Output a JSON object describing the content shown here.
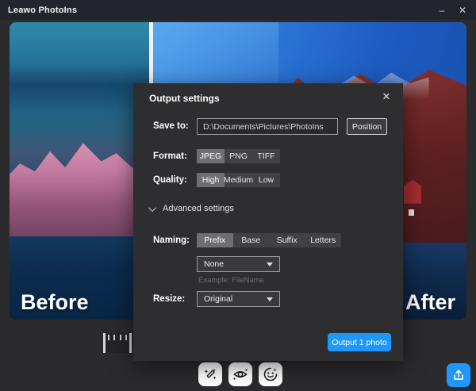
{
  "titlebar": {
    "title": "Leawo PhotoIns",
    "minimize": "–",
    "close": "✕"
  },
  "photo": {
    "before_label": "Before",
    "after_label": "After"
  },
  "dialog": {
    "title": "Output settings",
    "close": "✕",
    "save_to": {
      "label": "Save to:",
      "value": "D:\\Documents\\Pictures\\PhotoIns",
      "position_button": "Position"
    },
    "format": {
      "label": "Format:",
      "options": [
        "JPEG",
        "PNG",
        "TIFF"
      ],
      "selected": "JPEG"
    },
    "quality": {
      "label": "Quality:",
      "options": [
        "High",
        "Medium",
        "Low"
      ],
      "selected": "High"
    },
    "advanced": {
      "label": "Advanced settings"
    },
    "naming": {
      "label": "Naming:",
      "options": [
        "Prefix",
        "Base",
        "Suffix",
        "Letters"
      ],
      "selected": "Prefix",
      "value": "None",
      "example": "Example: FileName"
    },
    "resize": {
      "label": "Resize:",
      "value": "Original"
    },
    "output_button": "Output 1 photo"
  },
  "colors": {
    "accent_blue": "#1e97ff",
    "dialog_bg": "#2e2e30",
    "titlebar_bg": "#22252b"
  }
}
